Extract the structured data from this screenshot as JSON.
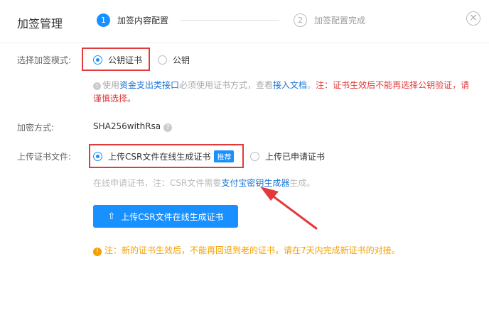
{
  "header": {
    "title": "加签管理",
    "steps": [
      {
        "num": "1",
        "label": "加签内容配置"
      },
      {
        "num": "2",
        "label": "加签配置完成"
      }
    ],
    "close_glyph": "×"
  },
  "mode": {
    "label": "选择加签模式:",
    "options": [
      "公钥证书",
      "公钥"
    ],
    "selected": "公钥证书"
  },
  "info": {
    "icon_glyph": "!",
    "prefix": "使用",
    "link1": "资金支出类接口",
    "mid": "必须使用证书方式，查看",
    "link2": "接入文档",
    "sep": "。",
    "warning": "注：证书生效后不能再选择公钥验证，请谨慎选择。"
  },
  "encrypt": {
    "label": "加密方式:",
    "value": "SHA256withRsa",
    "help_glyph": "?"
  },
  "upload": {
    "label": "上传证书文件:",
    "options": [
      "上传CSR文件在线生成证书",
      "上传已申请证书"
    ],
    "badge": "推荐",
    "hint_prefix": "在线申请证书，注：CSR文件需要",
    "hint_link": "支付宝密钥生成器",
    "hint_suffix": "生成。",
    "button_icon": "⇧",
    "button_label": "上传CSR文件在线生成证书"
  },
  "warning": {
    "icon_glyph": "!",
    "text": "注：新的证书生效后，不能再回退到老的证书，请在7天内完成新证书的对接。"
  },
  "colors": {
    "primary": "#1890ff",
    "annotation_red": "#e23a3a",
    "warning": "#f5a000"
  }
}
